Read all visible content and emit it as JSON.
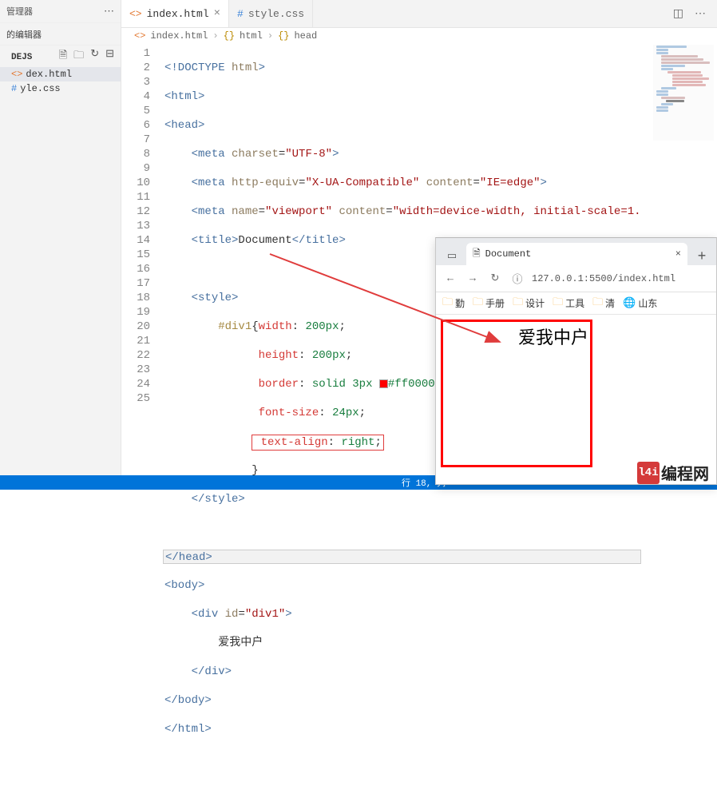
{
  "sidebar": {
    "title_suffix": "管理器",
    "open_editors_label": "的编辑器",
    "project_label": "DEJS",
    "files": [
      {
        "name": "dex.html",
        "type": "html"
      },
      {
        "name": "yle.css",
        "type": "css"
      }
    ]
  },
  "tabs": [
    {
      "label": "index.html",
      "active": true,
      "icon": "html"
    },
    {
      "label": "style.css",
      "active": false,
      "icon": "css"
    }
  ],
  "breadcrumb": [
    "index.html",
    "html",
    "head"
  ],
  "code": {
    "lines": [
      {
        "n": 1,
        "raw": "<!DOCTYPE html>"
      },
      {
        "n": 2,
        "raw": "<html>"
      },
      {
        "n": 3,
        "raw": "<head>"
      },
      {
        "n": 4,
        "raw": "    <meta charset=\"UTF-8\">"
      },
      {
        "n": 5,
        "raw": "    <meta http-equiv=\"X-UA-Compatible\" content=\"IE=edge\">"
      },
      {
        "n": 6,
        "raw": "    <meta name=\"viewport\" content=\"width=device-width, initial-scale=1."
      },
      {
        "n": 7,
        "raw": "    <title>Document</title>"
      },
      {
        "n": 8,
        "raw": ""
      },
      {
        "n": 9,
        "raw": "    <style>"
      },
      {
        "n": 10,
        "raw": "        #div1{width: 200px;"
      },
      {
        "n": 11,
        "raw": "              height: 200px;"
      },
      {
        "n": 12,
        "raw": "              border: solid 3px #ff0000;"
      },
      {
        "n": 13,
        "raw": "              font-size: 24px;"
      },
      {
        "n": 14,
        "raw": "              text-align: right;"
      },
      {
        "n": 15,
        "raw": "             }"
      },
      {
        "n": 16,
        "raw": "    </style>"
      },
      {
        "n": 17,
        "raw": ""
      },
      {
        "n": 18,
        "raw": "</head>"
      },
      {
        "n": 19,
        "raw": "<body>"
      },
      {
        "n": 20,
        "raw": "    <div id=\"div1\">"
      },
      {
        "n": 21,
        "raw": "        爱我中户"
      },
      {
        "n": 22,
        "raw": "    </div>"
      },
      {
        "n": 23,
        "raw": "</body>"
      },
      {
        "n": 24,
        "raw": "</html>"
      },
      {
        "n": 25,
        "raw": ""
      }
    ]
  },
  "statusbar": {
    "text": "行 18, 列"
  },
  "browser": {
    "tab_title": "Document",
    "url_prefix": "127.0.0.1:5500/index.html",
    "bookmarks": [
      "勤",
      "手册",
      "设计",
      "工具",
      "清",
      "山东"
    ],
    "rendered_text": "爱我中户"
  },
  "logo": {
    "badge": "l4i",
    "text": "编程网"
  }
}
